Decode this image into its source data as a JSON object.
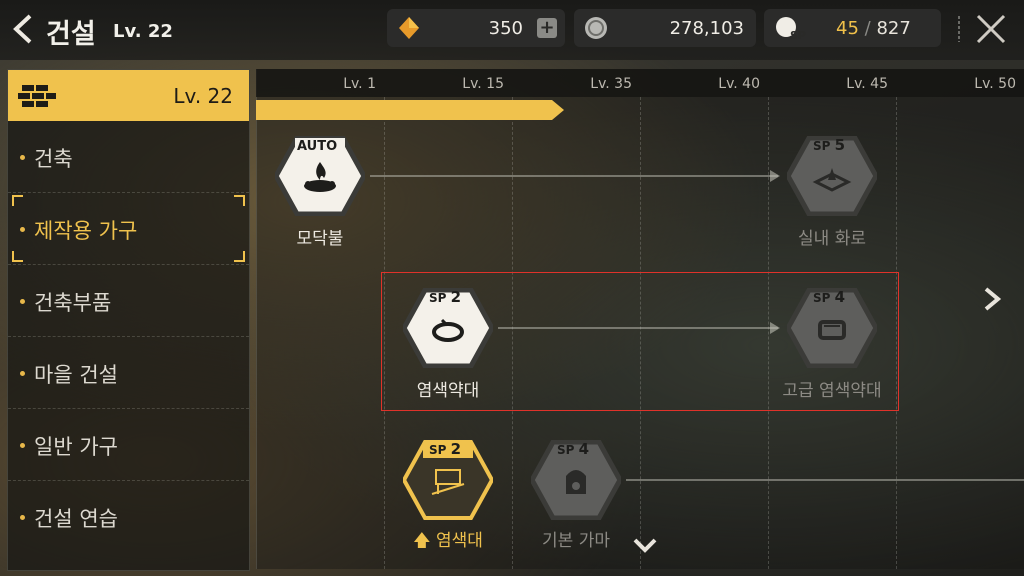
{
  "header": {
    "title": "건설",
    "level": "Lv. 22"
  },
  "resources": {
    "crystal": "350",
    "silver": "278,103",
    "sp_current": "45",
    "sp_separator": "/",
    "sp_max": "827",
    "sp_icon_text": "SP"
  },
  "sidebar": {
    "level": "Lv. 22",
    "items": [
      {
        "label": "건축"
      },
      {
        "label": "제작용 가구"
      },
      {
        "label": "건축부품"
      },
      {
        "label": "마을 건설"
      },
      {
        "label": "일반 가구"
      },
      {
        "label": "건설 연습"
      }
    ],
    "active_index": 1
  },
  "level_columns": [
    "Lv. 1",
    "Lv. 15",
    "Lv. 35",
    "Lv. 40",
    "Lv. 45",
    "Lv. 50"
  ],
  "nodes": {
    "campfire": {
      "badge": "AUTO",
      "label": "모닥불"
    },
    "indoor_brazier": {
      "badge_prefix": "SP",
      "badge_num": "5",
      "label": "실내 화로"
    },
    "dye_table": {
      "badge_prefix": "SP",
      "badge_num": "2",
      "label": "염색약대"
    },
    "adv_dye_table": {
      "badge_prefix": "SP",
      "badge_num": "4",
      "label": "고급 염색약대"
    },
    "dye_stand": {
      "badge_prefix": "SP",
      "badge_num": "2",
      "label": "염색대",
      "upgrade_glyph": "🡅"
    },
    "basic_kiln": {
      "badge_prefix": "SP",
      "badge_num": "4",
      "label": "기본 가마"
    }
  },
  "colors": {
    "accent": "#f0c24d",
    "highlight_box": "#e0322a",
    "locked": "#5e5e5c",
    "unlocked": "#f4f1ea"
  }
}
